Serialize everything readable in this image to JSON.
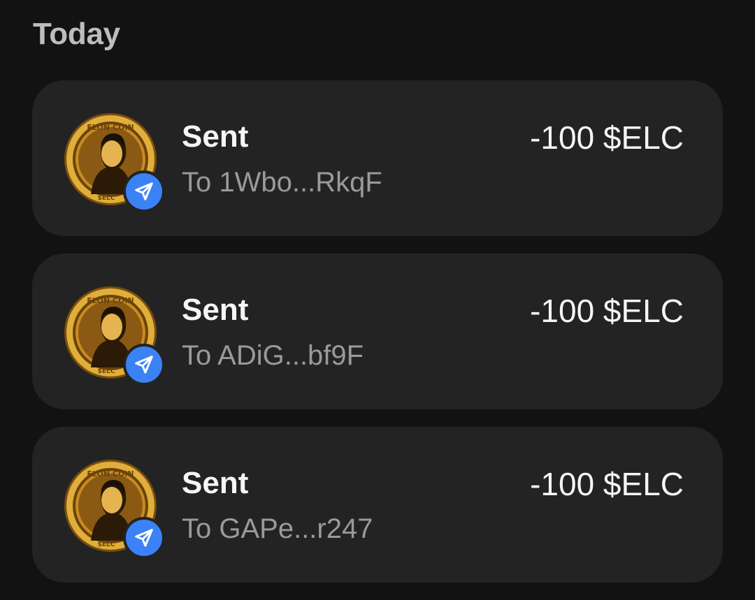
{
  "section": {
    "title": "Today"
  },
  "colors": {
    "background": "#121212",
    "card": "#232323",
    "badge": "#3b82f6",
    "coin_gold": "#d9a52c",
    "secondary_text": "#9a9a9a"
  },
  "transactions": [
    {
      "type": "Sent",
      "recipient": "To 1Wbo...RkqF",
      "amount": "-100 $ELC",
      "icon": "elon-coin-icon",
      "badge_icon": "send-arrow-icon"
    },
    {
      "type": "Sent",
      "recipient": "To ADiG...bf9F",
      "amount": "-100 $ELC",
      "icon": "elon-coin-icon",
      "badge_icon": "send-arrow-icon"
    },
    {
      "type": "Sent",
      "recipient": "To GAPe...r247",
      "amount": "-100 $ELC",
      "icon": "elon-coin-icon",
      "badge_icon": "send-arrow-icon"
    }
  ],
  "coin_logo": {
    "top_text": "ELON COIN",
    "bottom_text": "$ELC"
  }
}
